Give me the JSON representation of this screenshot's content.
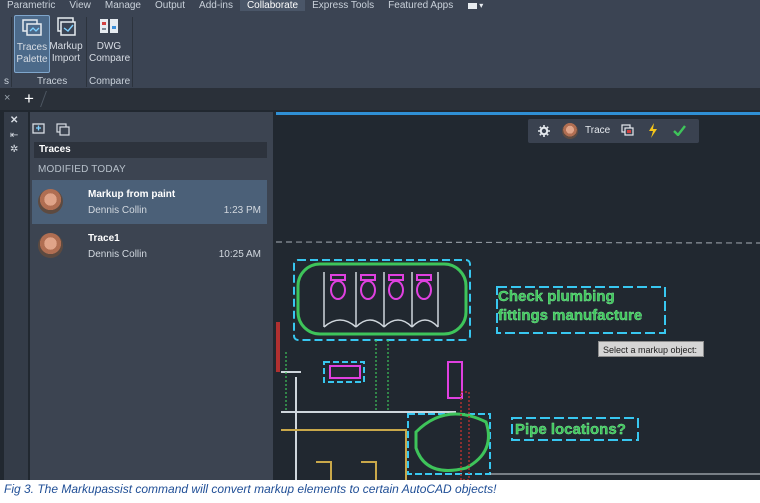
{
  "ribbon_tabs": [
    "Parametric",
    "View",
    "Manage",
    "Output",
    "Add-ins",
    "Collaborate",
    "Express Tools",
    "Featured Apps"
  ],
  "active_tab": "Collaborate",
  "ribbon": {
    "left_edge_panel": "s",
    "traces_palette": {
      "line1": "Traces",
      "line2": "Palette"
    },
    "markup_import": {
      "line1": "Markup",
      "line2": "Import"
    },
    "dwg_compare": {
      "line1": "DWG",
      "line2": "Compare"
    },
    "panel_traces": "Traces",
    "panel_compare": "Compare"
  },
  "filebar": {
    "close": "×",
    "new_tab": "+"
  },
  "palette": {
    "header": "Traces",
    "section": "MODIFIED TODAY",
    "items": [
      {
        "title": "Markup from paint",
        "author": "Dennis Collin",
        "time": "1:23 PM",
        "selected": true
      },
      {
        "title": "Trace1",
        "author": "Dennis Collin",
        "time": "10:25 AM",
        "selected": false
      }
    ]
  },
  "trace_toolbar": {
    "label": "Trace",
    "icons": [
      "gear-icon",
      "avatar",
      "markup-import-icon",
      "lightning-icon",
      "check-icon"
    ]
  },
  "drawing": {
    "markup_text_1_line1": "Check plumbing",
    "markup_text_1_line2": "fittings manufacture",
    "markup_text_2": "Pipe locations?",
    "tooltip": "Select a markup object:"
  },
  "caption": "Fig 3. The Markupassist command will convert markup elements to certain AutoCAD objects!",
  "colors": {
    "accent_blue": "#2f8fd4",
    "markup_green": "#3ec45a",
    "markup_cyan": "#38c7f0",
    "markup_magenta": "#e040e0",
    "markup_red": "#d03030",
    "caption_blue": "#1f4e96"
  }
}
